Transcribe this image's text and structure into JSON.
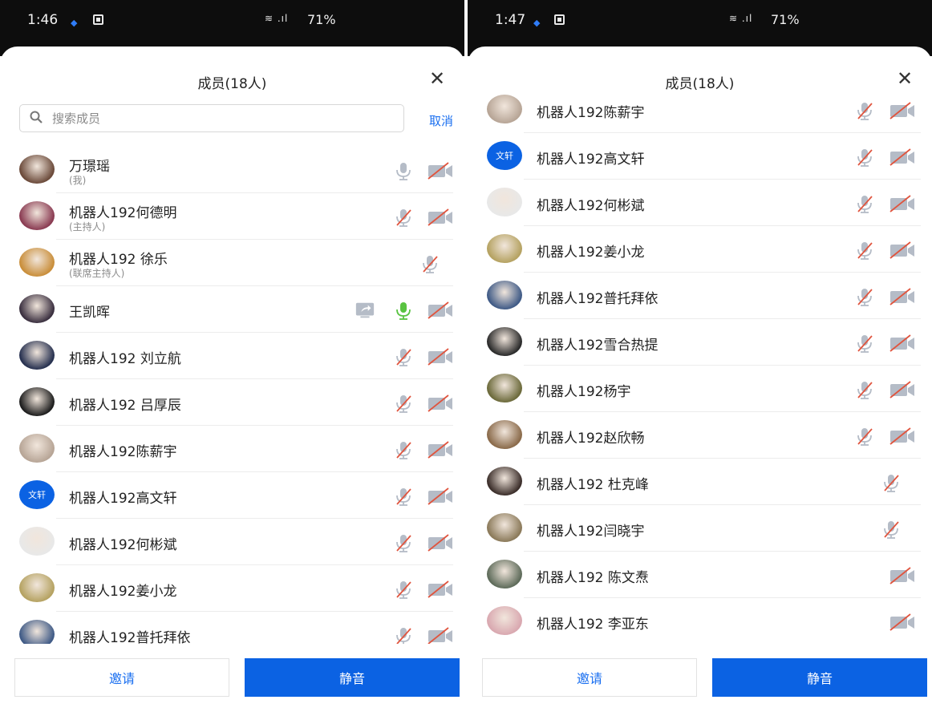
{
  "colors": {
    "accent": "#0b62e3",
    "link": "#1a6ff0",
    "speaking_mic": "#59c341",
    "muted_icon": "#b5bcc7",
    "slash": "#e0553f"
  },
  "left": {
    "status": {
      "time": "1:46",
      "battery": "71%"
    },
    "title": "成员(18人)",
    "search": {
      "placeholder": "搜索成员",
      "cancel": "取消"
    },
    "members": [
      {
        "name": "万璟瑶",
        "role": "(我)",
        "avatar": "#6b4a3a",
        "mic": "on",
        "cam": "off",
        "share": false
      },
      {
        "name": "机器人192何德明",
        "role": "(主持人)",
        "avatar": "#8a3b52",
        "mic": "muted",
        "cam": "off",
        "share": false
      },
      {
        "name": "机器人192 徐乐",
        "role": "(联席主持人)",
        "avatar": "#c98e3a",
        "mic": "muted",
        "cam": "none",
        "share": false
      },
      {
        "name": "王凯晖",
        "role": "",
        "avatar": "#3a2f3f",
        "mic": "speaking",
        "cam": "off",
        "share": true
      },
      {
        "name": "机器人192 刘立航",
        "role": "",
        "avatar": "#26304f",
        "mic": "muted",
        "cam": "off",
        "share": false
      },
      {
        "name": "机器人192 吕厚辰",
        "role": "",
        "avatar": "#1d1d1d",
        "mic": "muted",
        "cam": "off",
        "share": false
      },
      {
        "name": "机器人192陈薪宇",
        "role": "",
        "avatar": "#b7a596",
        "mic": "muted",
        "cam": "off",
        "share": false
      },
      {
        "name": "机器人192高文轩",
        "role": "",
        "avatar": "#0b62e3",
        "avatar_text": "文轩",
        "mic": "muted",
        "cam": "off",
        "share": false
      },
      {
        "name": "机器人192何彬斌",
        "role": "",
        "avatar": "#e8e8e8",
        "mic": "muted",
        "cam": "off",
        "share": false
      },
      {
        "name": "机器人192姜小龙",
        "role": "",
        "avatar": "#b5a261",
        "mic": "muted",
        "cam": "off",
        "share": false
      },
      {
        "name": "机器人192普托拜依",
        "role": "",
        "avatar": "#3f5a86",
        "mic": "muted",
        "cam": "off",
        "share": false
      }
    ],
    "invite": "邀请",
    "mute": "静音"
  },
  "right": {
    "status": {
      "time": "1:47",
      "battery": "71%"
    },
    "title": "成员(18人)",
    "members": [
      {
        "name": "机器人192陈薪宇",
        "avatar": "#b7a596",
        "mic": "muted",
        "cam": "off"
      },
      {
        "name": "机器人192高文轩",
        "avatar": "#0b62e3",
        "avatar_text": "文轩",
        "mic": "muted",
        "cam": "off"
      },
      {
        "name": "机器人192何彬斌",
        "avatar": "#e8e8e8",
        "mic": "muted",
        "cam": "off"
      },
      {
        "name": "机器人192姜小龙",
        "avatar": "#b5a261",
        "mic": "muted",
        "cam": "off"
      },
      {
        "name": "机器人192普托拜依",
        "avatar": "#3f5a86",
        "mic": "muted",
        "cam": "off"
      },
      {
        "name": "机器人192雪合热提",
        "avatar": "#2a2a2a",
        "mic": "muted",
        "cam": "off"
      },
      {
        "name": "机器人192杨宇",
        "avatar": "#6c6a3b",
        "mic": "muted",
        "cam": "off"
      },
      {
        "name": "机器人192赵欣畅",
        "avatar": "#8a6a4a",
        "mic": "muted",
        "cam": "off"
      },
      {
        "name": "机器人192 杜克峰",
        "avatar": "#3b2e2a",
        "mic": "muted",
        "cam": "none"
      },
      {
        "name": "机器人192闫晓宇",
        "avatar": "#8b7a5a",
        "mic": "muted",
        "cam": "none"
      },
      {
        "name": "机器人192 陈文焘",
        "avatar": "#5e6b5a",
        "mic": "none",
        "cam": "off"
      },
      {
        "name": "机器人192 李亚东",
        "avatar": "#d9a8b0",
        "mic": "none",
        "cam": "off"
      }
    ],
    "invite": "邀请",
    "mute": "静音"
  }
}
